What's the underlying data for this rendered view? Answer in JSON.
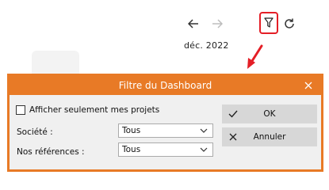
{
  "toolbar": {
    "date_label": "déc. 2022",
    "icons": {
      "back": "arrow-left-icon",
      "forward": "arrow-right-icon",
      "filter": "funnel-filter-icon",
      "refresh": "refresh-icon"
    },
    "highlight_color": "#e41e26"
  },
  "dialog": {
    "title": "Filtre du Dashboard",
    "accent_color": "#e87a26",
    "only_my_projects_label": "Afficher seulement mes projets",
    "only_my_projects_checked": false,
    "societe": {
      "label": "Société :",
      "value": "Tous"
    },
    "references": {
      "label": "Nos références :",
      "value": "Tous"
    },
    "ok_label": "OK",
    "cancel_label": "Annuler"
  }
}
